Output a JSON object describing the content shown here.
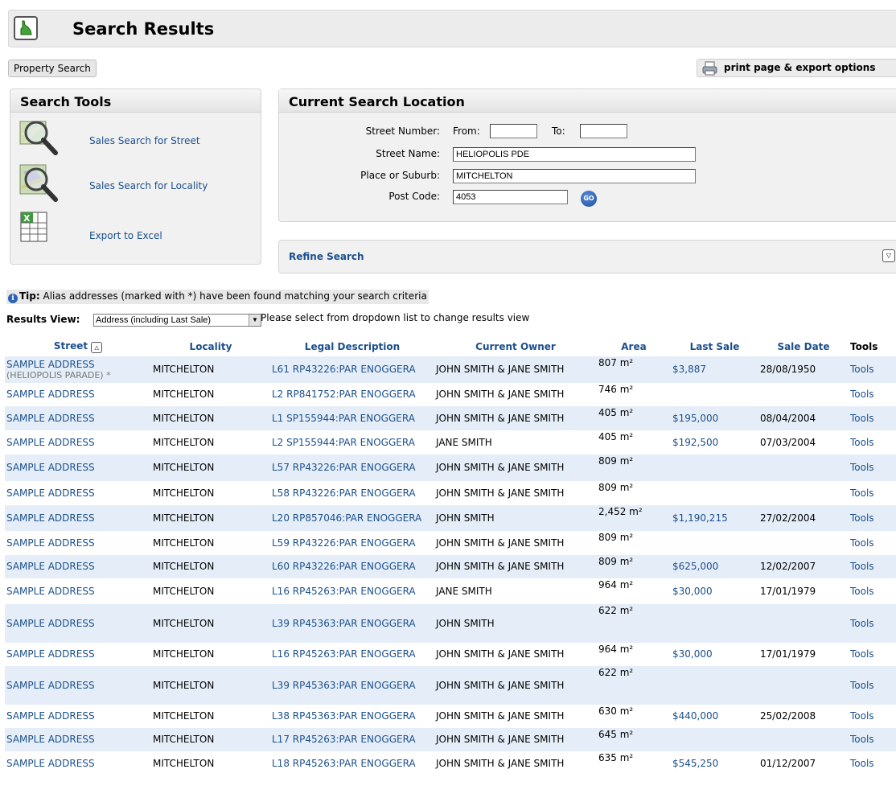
{
  "header": {
    "title": "Search Results"
  },
  "toolbar": {
    "property_search": "Property Search",
    "print_export": "print page & export options"
  },
  "search_tools": {
    "title": "Search Tools",
    "items": [
      {
        "label": "Sales Search for Street",
        "icon": "magnifier-street-icon"
      },
      {
        "label": "Sales Search for Locality",
        "icon": "magnifier-map-icon"
      },
      {
        "label": "Export to Excel",
        "icon": "excel-icon"
      }
    ]
  },
  "location": {
    "title": "Current Search Location",
    "street_number_label": "Street Number:",
    "from_label": "From:",
    "to_label": "To:",
    "from_value": "",
    "to_value": "",
    "street_name_label": "Street Name:",
    "street_name": "HELIOPOLIS PDE",
    "suburb_label": "Place or Suburb:",
    "suburb": "MITCHELTON",
    "postcode_label": "Post Code:",
    "postcode": "4053",
    "go": "GO"
  },
  "refine": {
    "label": "Refine Search"
  },
  "tip": {
    "prefix": "Tip:",
    "text": "Alias addresses (marked with *) have been found matching your search criteria"
  },
  "results_view": {
    "label": "Results View:",
    "selected": "Address (including Last Sale)",
    "hint": "Please select from dropdown list to change results view"
  },
  "table": {
    "headers": [
      "Street",
      "Locality",
      "Legal Description",
      "Current Owner",
      "Area",
      "Last Sale",
      "Sale Date",
      "Tools"
    ],
    "rows": [
      {
        "street": "SAMPLE ADDRESS",
        "alias": "(HELIOPOLIS PARADE) *",
        "locality": "MITCHELTON",
        "legal": "L61 RP43226:PAR ENOGGERA",
        "owner": "JOHN SMITH & JANE SMITH",
        "area": "807 m²",
        "last_sale": "$3,887",
        "sale_date": "28/08/1950",
        "tools": "Tools"
      },
      {
        "street": "SAMPLE ADDRESS",
        "locality": "MITCHELTON",
        "legal": "L2 RP841752:PAR ENOGGERA",
        "owner": "JOHN SMITH & JANE SMITH",
        "area": "746 m²",
        "last_sale": "",
        "sale_date": "",
        "tools": "Tools"
      },
      {
        "street": "SAMPLE ADDRESS",
        "locality": "MITCHELTON",
        "legal": "L1 SP155944:PAR ENOGGERA",
        "owner": "JOHN SMITH & JANE SMITH",
        "area": "405 m²",
        "last_sale": "$195,000",
        "sale_date": "08/04/2004",
        "tools": "Tools"
      },
      {
        "street": "SAMPLE ADDRESS",
        "locality": "MITCHELTON",
        "legal": "L2 SP155944:PAR ENOGGERA",
        "owner": "JANE SMITH",
        "area": "405 m²",
        "last_sale": "$192,500",
        "sale_date": "07/03/2004",
        "tools": "Tools"
      },
      {
        "street": "SAMPLE ADDRESS",
        "locality": "MITCHELTON",
        "legal": "L57 RP43226:PAR ENOGGERA",
        "owner": "JOHN SMITH & JANE SMITH",
        "area": "809 m²",
        "last_sale": "",
        "sale_date": "",
        "tools": "Tools"
      },
      {
        "street": "SAMPLE ADDRESS",
        "locality": "MITCHELTON",
        "legal": "L58 RP43226:PAR ENOGGERA",
        "owner": "JOHN SMITH & JANE SMITH",
        "area": "809 m²",
        "last_sale": "",
        "sale_date": "",
        "tools": "Tools"
      },
      {
        "street": "SAMPLE ADDRESS",
        "locality": "MITCHELTON",
        "legal": "L20 RP857046:PAR ENOGGERA",
        "owner": "JOHN SMITH",
        "area": "2,452 m²",
        "last_sale": "$1,190,215",
        "sale_date": "27/02/2004",
        "tools": "Tools"
      },
      {
        "street": "SAMPLE ADDRESS",
        "locality": "MITCHELTON",
        "legal": "L59 RP43226:PAR ENOGGERA",
        "owner": "JOHN SMITH & JANE SMITH",
        "area": "809 m²",
        "last_sale": "",
        "sale_date": "",
        "tools": "Tools"
      },
      {
        "street": "SAMPLE ADDRESS",
        "locality": "MITCHELTON",
        "legal": "L60 RP43226:PAR ENOGGERA",
        "owner": "JOHN SMITH & JANE SMITH",
        "area": "809 m²",
        "last_sale": "$625,000",
        "sale_date": "12/02/2007",
        "tools": "Tools"
      },
      {
        "street": "SAMPLE ADDRESS",
        "locality": "MITCHELTON",
        "legal": "L16 RP45263:PAR ENOGGERA",
        "owner": "JANE SMITH",
        "area": "964 m²",
        "last_sale": "$30,000",
        "sale_date": "17/01/1979",
        "tools": "Tools"
      },
      {
        "street": "SAMPLE ADDRESS",
        "locality": "MITCHELTON",
        "legal": "L39 RP45363:PAR ENOGGERA",
        "owner": "JOHN SMITH",
        "area": "622 m²",
        "last_sale": "",
        "sale_date": "",
        "tools": "Tools"
      },
      {
        "street": "SAMPLE ADDRESS",
        "locality": "MITCHELTON",
        "legal": "L16 RP45263:PAR ENOGGERA",
        "owner": "JOHN SMITH & JANE SMITH",
        "area": "964 m²",
        "last_sale": "$30,000",
        "sale_date": "17/01/1979",
        "tools": "Tools"
      },
      {
        "street": "SAMPLE ADDRESS",
        "locality": "MITCHELTON",
        "legal": "L39 RP45363:PAR ENOGGERA",
        "owner": "JOHN SMITH & JANE SMITH",
        "area": "622 m²",
        "last_sale": "",
        "sale_date": "",
        "tools": "Tools"
      },
      {
        "street": "SAMPLE ADDRESS",
        "locality": "MITCHELTON",
        "legal": "L38 RP45363:PAR ENOGGERA",
        "owner": "JOHN SMITH & JANE SMITH",
        "area": "630 m²",
        "last_sale": "$440,000",
        "sale_date": "25/02/2008",
        "tools": "Tools"
      },
      {
        "street": "SAMPLE ADDRESS",
        "locality": "MITCHELTON",
        "legal": "L17 RP45263:PAR ENOGGERA",
        "owner": "JOHN SMITH & JANE SMITH",
        "area": "645 m²",
        "last_sale": "",
        "sale_date": "",
        "tools": "Tools"
      },
      {
        "street": "SAMPLE ADDRESS",
        "locality": "MITCHELTON",
        "legal": "L18 RP45263:PAR ENOGGERA",
        "owner": "JOHN SMITH & JANE SMITH",
        "area": "635 m²",
        "last_sale": "$545,250",
        "sale_date": "01/12/2007",
        "tools": "Tools"
      }
    ]
  },
  "colors": {
    "link": "#1b4f8c",
    "row_alt": "#e5eef8",
    "panel_bg": "#f1f1f1"
  }
}
